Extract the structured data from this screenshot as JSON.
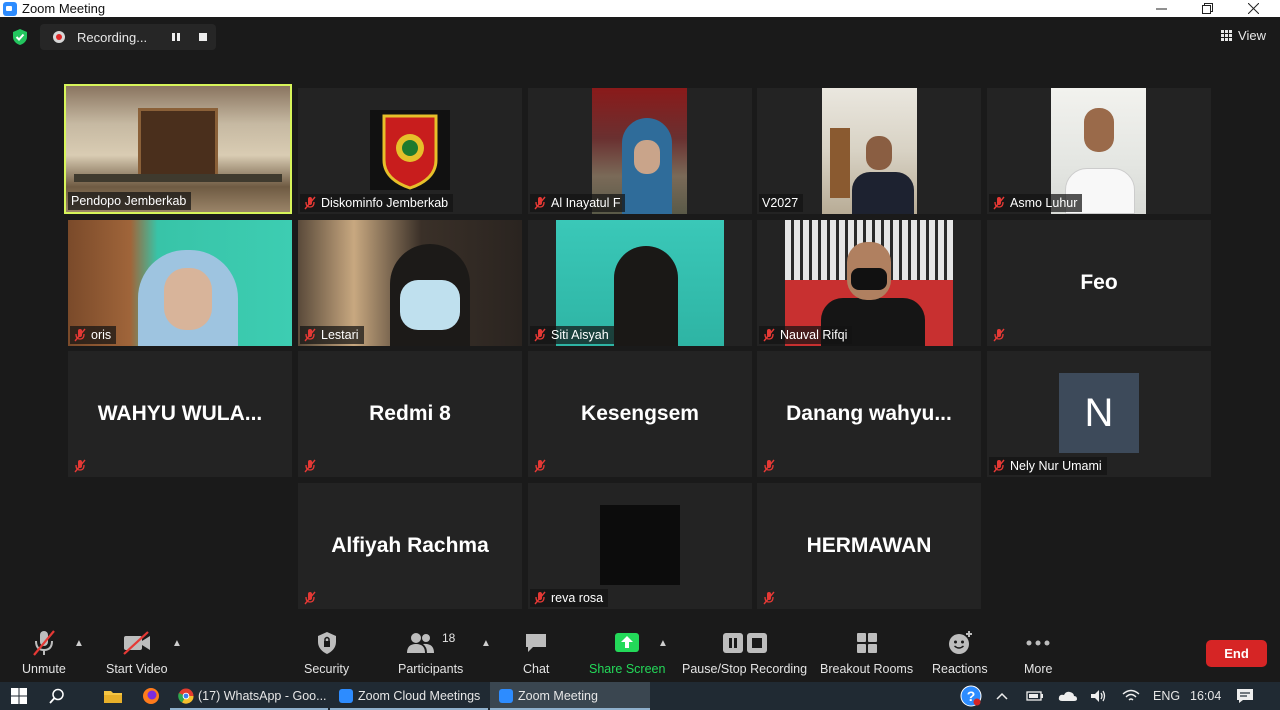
{
  "window": {
    "title": "Zoom Meeting"
  },
  "recording": {
    "label": "Recording..."
  },
  "view": {
    "label": "View"
  },
  "tiles": [
    {
      "name": "Pendopo Jemberkab",
      "muted": false,
      "active": true
    },
    {
      "name": "Diskominfo Jemberkab",
      "muted": true
    },
    {
      "name": "Al Inayatul F",
      "muted": true
    },
    {
      "name": "V2027",
      "muted": false
    },
    {
      "name": "Asmo Luhur",
      "muted": true
    },
    {
      "name": "oris",
      "muted": true
    },
    {
      "name": "Lestari",
      "muted": true
    },
    {
      "name": "Siti Aisyah",
      "muted": true
    },
    {
      "name": "Nauval Rifqi",
      "muted": true
    },
    {
      "display": "Feo",
      "muted": true
    },
    {
      "display": "WAHYU  WULA...",
      "muted": true
    },
    {
      "display": "Redmi 8",
      "muted": true
    },
    {
      "display": "Kesengsem",
      "muted": true
    },
    {
      "display": "Danang  wahyu...",
      "muted": true
    },
    {
      "name": "Nely Nur Umami",
      "avatar": "N",
      "muted": true
    },
    {
      "display": "Alfiyah Rachma",
      "muted": true
    },
    {
      "name": "reva rosa",
      "muted": true
    },
    {
      "display": "HERMAWAN",
      "muted": true
    }
  ],
  "toolbar": {
    "unmute": "Unmute",
    "start_video": "Start Video",
    "security": "Security",
    "participants": "Participants",
    "participants_count": "18",
    "chat": "Chat",
    "share_screen": "Share Screen",
    "pause_stop_recording": "Pause/Stop Recording",
    "breakout_rooms": "Breakout Rooms",
    "reactions": "Reactions",
    "more": "More",
    "end": "End",
    "share_color": "#23d959"
  },
  "taskbar": {
    "whatsapp": "(17) WhatsApp - Goo...",
    "zoom_cloud": "Zoom Cloud Meetings",
    "zoom_meeting": "Zoom Meeting",
    "lang": "ENG",
    "time": "16:04"
  }
}
